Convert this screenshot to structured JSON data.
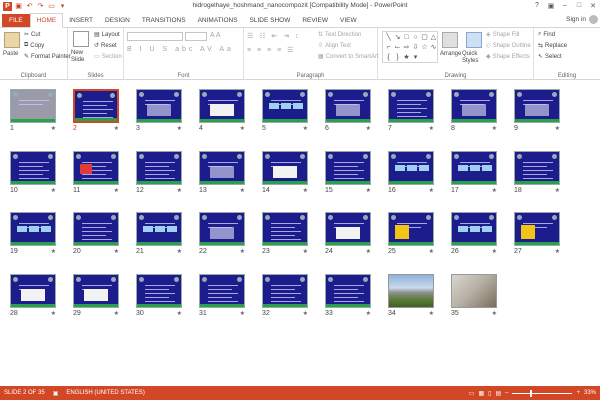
{
  "window": {
    "title": "hidrogelhaye_hoshmand_nanocompozit [Compatibility Mode] - PowerPoint"
  },
  "tabs": [
    "FILE",
    "HOME",
    "INSERT",
    "DESIGN",
    "TRANSITIONS",
    "ANIMATIONS",
    "SLIDE SHOW",
    "REVIEW",
    "VIEW"
  ],
  "active_tab": "HOME",
  "signin": "Sign in",
  "ribbon": {
    "clipboard": {
      "paste": "Paste",
      "cut": "Cut",
      "copy": "Copy",
      "format_painter": "Format Painter",
      "label": "Clipboard"
    },
    "slides": {
      "new_slide": "New Slide",
      "layout": "Layout",
      "reset": "Reset",
      "section": "Section",
      "label": "Slides"
    },
    "font": {
      "label": "Font"
    },
    "paragraph": {
      "text_direction": "Text Direction",
      "align_text": "Align Text",
      "convert_smartart": "Convert to SmartArt",
      "label": "Paragraph"
    },
    "drawing": {
      "arrange": "Arrange",
      "quick_styles": "Quick Styles",
      "shape_fill": "Shape Fill",
      "shape_outline": "Shape Outline",
      "shape_effects": "Shape Effects",
      "label": "Drawing"
    },
    "editing": {
      "find": "Find",
      "replace": "Replace",
      "select": "Select",
      "label": "Editing"
    }
  },
  "slides": [
    {
      "n": "1",
      "kind": "gray"
    },
    {
      "n": "2",
      "kind": "text",
      "selected": true
    },
    {
      "n": "3",
      "kind": "diagram"
    },
    {
      "n": "4",
      "kind": "white-diagram"
    },
    {
      "n": "5",
      "kind": "boxes"
    },
    {
      "n": "6",
      "kind": "diagram"
    },
    {
      "n": "7",
      "kind": "text"
    },
    {
      "n": "8",
      "kind": "diagram"
    },
    {
      "n": "9",
      "kind": "diagram"
    },
    {
      "n": "10",
      "kind": "text"
    },
    {
      "n": "11",
      "kind": "red-text"
    },
    {
      "n": "12",
      "kind": "text"
    },
    {
      "n": "13",
      "kind": "diagram"
    },
    {
      "n": "14",
      "kind": "white-diagram"
    },
    {
      "n": "15",
      "kind": "text"
    },
    {
      "n": "16",
      "kind": "boxes"
    },
    {
      "n": "17",
      "kind": "boxes"
    },
    {
      "n": "18",
      "kind": "text"
    },
    {
      "n": "19",
      "kind": "boxes"
    },
    {
      "n": "20",
      "kind": "text"
    },
    {
      "n": "21",
      "kind": "boxes"
    },
    {
      "n": "22",
      "kind": "diagram"
    },
    {
      "n": "23",
      "kind": "text"
    },
    {
      "n": "24",
      "kind": "white-diagram"
    },
    {
      "n": "25",
      "kind": "yellow"
    },
    {
      "n": "26",
      "kind": "boxes"
    },
    {
      "n": "27",
      "kind": "yellow"
    },
    {
      "n": "28",
      "kind": "white-diagram"
    },
    {
      "n": "29",
      "kind": "white-diagram"
    },
    {
      "n": "30",
      "kind": "text"
    },
    {
      "n": "31",
      "kind": "text"
    },
    {
      "n": "32",
      "kind": "text"
    },
    {
      "n": "33",
      "kind": "text"
    },
    {
      "n": "34",
      "kind": "photo-mountain"
    },
    {
      "n": "35",
      "kind": "photo-laptop"
    }
  ],
  "status": {
    "slide": "SLIDE 2 OF 35",
    "language": "ENGLISH (UNITED STATES)",
    "zoom": "33%"
  },
  "colors": {
    "accent": "#d24726",
    "slide_bg": "#1c1c8c",
    "slide_bar": "#28a24a"
  }
}
